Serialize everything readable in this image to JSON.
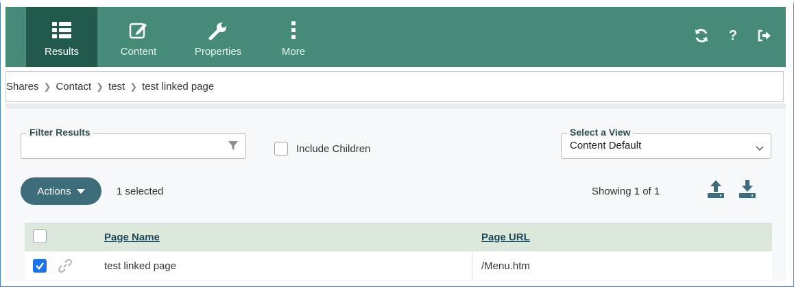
{
  "toolbar": {
    "items": [
      {
        "label": "Results",
        "icon": "list-icon",
        "active": true
      },
      {
        "label": "Content",
        "icon": "edit-icon",
        "active": false
      },
      {
        "label": "Properties",
        "icon": "wrench-icon",
        "active": false
      },
      {
        "label": "More",
        "icon": "more-vertical-icon",
        "active": false
      }
    ],
    "right_icons": [
      "refresh-icon",
      "help-icon",
      "sign-out-icon"
    ],
    "help_glyph": "?"
  },
  "breadcrumb": [
    "Shares",
    "Contact",
    "test",
    "test linked page"
  ],
  "filter": {
    "legend": "Filter Results",
    "value": "",
    "placeholder": ""
  },
  "include_children": {
    "label": "Include Children",
    "checked": false
  },
  "view": {
    "legend": "Select a View",
    "selected": "Content Default"
  },
  "actions": {
    "label": "Actions",
    "selected_text": "1 selected"
  },
  "paging": {
    "showing": "Showing 1 of 1"
  },
  "table": {
    "headers": [
      "Page Name",
      "Page URL"
    ],
    "rows": [
      {
        "checked": true,
        "linked": true,
        "page_name": "test linked page",
        "page_url": "/Menu.htm"
      }
    ]
  },
  "colors": {
    "toolbar": "#468b77",
    "toolbar_active": "#215a4c",
    "actions_button": "#3d6d7b",
    "table_header": "#dde8dd",
    "checkbox_checked": "#1a73e8"
  }
}
